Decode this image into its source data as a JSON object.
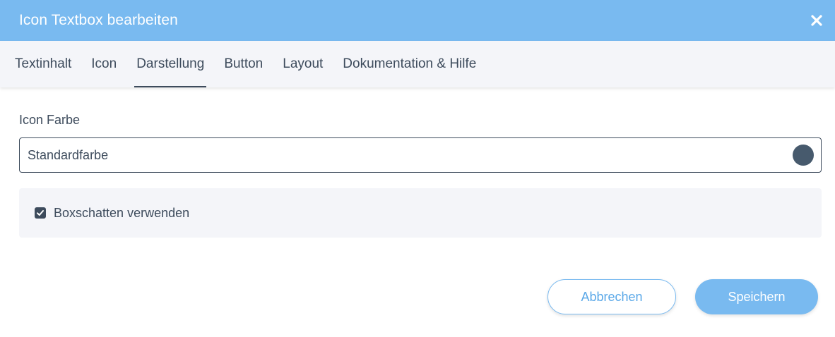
{
  "header": {
    "title": "Icon Textbox bearbeiten",
    "close_icon": "close-icon"
  },
  "tabs": [
    {
      "label": "Textinhalt",
      "active": false
    },
    {
      "label": "Icon",
      "active": false
    },
    {
      "label": "Darstellung",
      "active": true
    },
    {
      "label": "Button",
      "active": false
    },
    {
      "label": "Layout",
      "active": false
    },
    {
      "label": "Dokumentation & Hilfe",
      "active": false
    }
  ],
  "icon_color": {
    "label": "Icon Farbe",
    "value": "Standardfarbe",
    "swatch_color": "#475a6d"
  },
  "box_shadow": {
    "label": "Boxschatten verwenden",
    "checked": true
  },
  "actions": {
    "cancel_label": "Abbrechen",
    "save_label": "Speichern"
  },
  "colors": {
    "accent": "#79baf0",
    "text": "#3d4b5c",
    "tab_background": "#f4f5f9"
  }
}
